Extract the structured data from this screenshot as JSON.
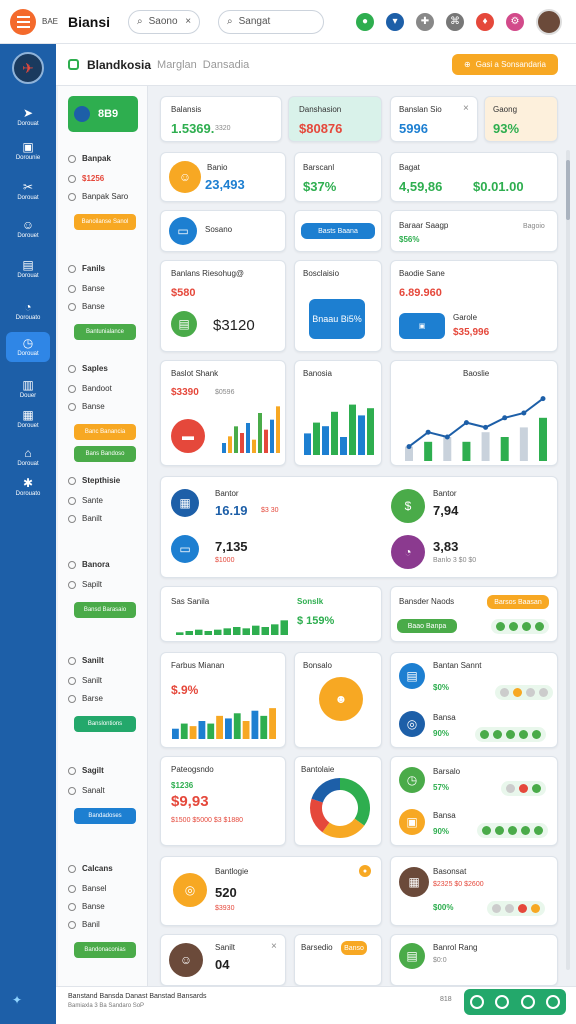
{
  "app": {
    "small": "BAE",
    "title": "Biansi",
    "search1": "Saono",
    "search2": "Sangat"
  },
  "header": {
    "title": "Blandkosia",
    "tag": "Marglan",
    "subtitle": "Dansadia",
    "button": "Gasi a Sonsandaria"
  },
  "sidebar": [
    {
      "label": "Dorouat",
      "icon": "flag-icon"
    },
    {
      "label": "Dorounie",
      "icon": "user-icon"
    },
    {
      "label": "Dorouat",
      "icon": "people-icon"
    },
    {
      "label": "Dorouet",
      "icon": "calendar-icon"
    },
    {
      "label": "Dorouat",
      "icon": "chart-icon"
    },
    {
      "label": "Dorouato",
      "icon": "clock-icon"
    },
    {
      "label": "Dorouat",
      "icon": "briefcase-icon"
    },
    {
      "label": "Douer",
      "icon": "doc-icon"
    },
    {
      "label": "Dorouet",
      "icon": "group-icon"
    },
    {
      "label": "Dorouat",
      "icon": "page-icon"
    },
    {
      "label": "Dorouato",
      "icon": "settings-icon"
    }
  ],
  "left": {
    "balance": "8B9",
    "sections": [
      {
        "title": "Banpak",
        "v1": "$1256",
        "v2": "Banpak Saro",
        "btn": "Banoilanse Sanol"
      },
      {
        "title": "Fanils",
        "v1": "Banse",
        "v2": "Banse",
        "btn": "Bantunialance"
      },
      {
        "title": "Saples",
        "v1": "Bandoot",
        "v2": "Banse",
        "btn": "Banc Banancia",
        "btn2": "Bans Bandoso"
      },
      {
        "title": "Stepthisie",
        "v1": "Sante",
        "v2": "Banilt"
      },
      {
        "title": "Banora",
        "v1": "Sapilt",
        "btn": "Bansd Barasaio"
      },
      {
        "title": "Sanilt",
        "v1": "Sanilt",
        "v2": "Barse",
        "btn": "Banslontions"
      },
      {
        "title": "Sagilt",
        "v1": "Sanalt",
        "btn": "Bandadoses"
      },
      {
        "title": "Calcans",
        "v1": "Bansel",
        "v2": "Banse",
        "v3": "Banil",
        "btn": "Bandonaconias"
      }
    ]
  },
  "cards": {
    "r1": [
      {
        "label": "Balansis",
        "value": "1.5369.",
        "sub": "3320"
      },
      {
        "label": "Danshasion",
        "value": "$80876"
      },
      {
        "label": "Banslan Sio",
        "value": "5996"
      },
      {
        "label": "Gaong",
        "value": "93%"
      }
    ],
    "r2": [
      {
        "label": "Banio",
        "value": "23,493"
      },
      {
        "label": "Barscanl",
        "value": "$37%"
      },
      {
        "label": "Bagat",
        "value": "4,59,86",
        "value2": "$0.01.00"
      }
    ],
    "r3": [
      {
        "label": "Sosano",
        "btn": "Basts Baana"
      },
      {
        "label": "Baraar Saagp",
        "value": "$56%",
        "sub": "Bagoio"
      }
    ],
    "r4": [
      {
        "label": "Banlans Riesohug@",
        "value": "$580",
        "value2": "$3120"
      },
      {
        "label": "Bosclaisio",
        "value": "Bnaau Bi5%"
      },
      {
        "label": "Baodie Sane",
        "value": "6.89.960",
        "sub": "Garole",
        "value2": "$35,996"
      }
    ],
    "r5": [
      {
        "label": "Baslot Shank",
        "value": "$3390",
        "sub": "$0596"
      },
      {
        "label": "Banosia"
      },
      {
        "label": "Baoslie"
      }
    ],
    "r6": [
      {
        "label": "Bantor",
        "value": "16.19",
        "sub": "$3 30"
      },
      {
        "label": "Bantor",
        "value": "7,94"
      },
      {
        "label": "",
        "value": "7,135",
        "sub": "$1000"
      },
      {
        "label": "",
        "value": "3,83",
        "sub": "Banlo 3 $0 $0"
      }
    ],
    "r7": [
      {
        "label": "Sas Sanila"
      },
      {
        "label": "Sonslk",
        "value": "$ 159%"
      },
      {
        "label": "Bansder Naods",
        "btn": "Barsos Baasan",
        "btn2": "Baao Banpa"
      }
    ],
    "r8": [
      {
        "label": "Farbus Mianan",
        "value": "$.9%"
      },
      {
        "label": "Bonsalo"
      },
      {
        "label": "Bantan Sannt",
        "value": "$0%",
        "v2": "Bansa",
        "value2": "90%"
      }
    ],
    "r9": [
      {
        "label": "Pateogsndo",
        "value": "$1236",
        "value2": "$9,93",
        "sub": "$1500 $5000 $3 $1880"
      },
      {
        "label": "Bantolaie"
      },
      {
        "label": "Barsalo",
        "value": "57%",
        "v2": "Bansa",
        "value2": "90%"
      }
    ],
    "r10": [
      {
        "label": "Bantlogie",
        "value": "520",
        "sub": "$3930"
      },
      {
        "label": "Basonsat",
        "value": "$2325 $0 $2600",
        "value2": "$00%"
      }
    ],
    "r11": [
      {
        "label": "Sanilt",
        "value": "04"
      },
      {
        "label": "Barsedio",
        "tag": "Banso"
      },
      {
        "label": "Banrol Rang",
        "sub": "$0:0"
      }
    ]
  },
  "bottom": {
    "line1": "Banstand Bansda Danast Banstad Bansards",
    "line2": "Bamiaxla 3 Ba Sandaro SoP",
    "code": "818"
  },
  "chart_data": [
    {
      "type": "bar",
      "series": [
        {
          "name": "",
          "values": [
            3,
            5,
            8,
            6,
            9,
            4,
            12,
            7,
            10,
            14
          ]
        }
      ],
      "ylim": [
        0,
        15
      ]
    },
    {
      "type": "bar",
      "series": [
        {
          "name": "",
          "values": [
            6,
            9,
            8,
            12,
            5,
            14,
            11,
            13
          ]
        }
      ],
      "ylim": [
        0,
        15
      ]
    },
    {
      "type": "line",
      "x": [
        1,
        2,
        3,
        4,
        5,
        6,
        7,
        8
      ],
      "series": [
        {
          "name": "",
          "values": [
            3,
            6,
            5,
            8,
            7,
            9,
            10,
            13
          ]
        }
      ],
      "bars": [
        3,
        4,
        5,
        4,
        6,
        5,
        7,
        9
      ],
      "ylim": [
        0,
        15
      ]
    },
    {
      "type": "bar",
      "series": [
        {
          "name": "",
          "values": [
            2,
            3,
            4,
            3,
            4,
            5,
            6,
            5,
            7,
            6,
            8,
            11
          ]
        }
      ],
      "ylim": [
        0,
        12
      ]
    },
    {
      "type": "bar",
      "series": [
        {
          "name": "",
          "values": [
            4,
            6,
            5,
            7,
            6,
            9,
            8,
            10,
            7,
            11,
            9,
            12
          ]
        }
      ],
      "ylim": [
        0,
        14
      ]
    },
    {
      "type": "pie",
      "values": [
        35,
        25,
        20,
        20
      ],
      "colors": [
        "#2eae4f",
        "#f7a823",
        "#e5483b",
        "#1d5fa8"
      ]
    }
  ]
}
